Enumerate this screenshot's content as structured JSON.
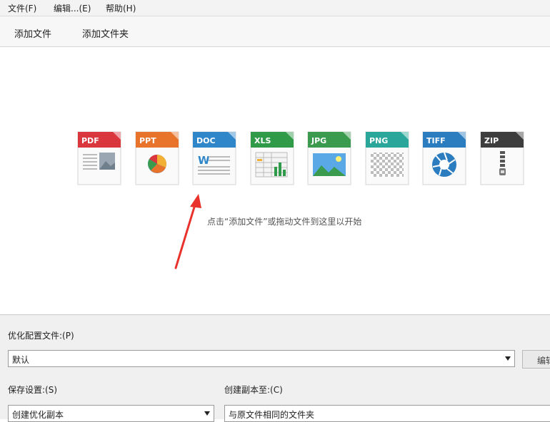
{
  "menu": {
    "file": "文件(F)",
    "edit": "编辑...(E)",
    "help": "帮助(H)"
  },
  "toolbar": {
    "add_file": "添加文件",
    "add_folder": "添加文件夹"
  },
  "file_types": [
    {
      "label": "PDF",
      "color": "#d9363e"
    },
    {
      "label": "PPT",
      "color": "#e8742c"
    },
    {
      "label": "DOC",
      "color": "#2f86c9"
    },
    {
      "label": "XLS",
      "color": "#2f9a48"
    },
    {
      "label": "JPG",
      "color": "#3a9a4e"
    },
    {
      "label": "PNG",
      "color": "#2aa69a"
    },
    {
      "label": "TIFF",
      "color": "#2c7cc0"
    },
    {
      "label": "ZIP",
      "color": "#3d3d3d"
    }
  ],
  "drop_hint": "点击“添加文件”或拖动文件到这里以开始",
  "profile": {
    "label": "优化配置文件:(P)",
    "value": "默认",
    "edit_button": "编辑"
  },
  "save": {
    "label": "保存设置:(S)",
    "value": "创建优化副本"
  },
  "copy_to": {
    "label": "创建副本至:(C)",
    "value": "与原文件相同的文件夹"
  },
  "colors": {
    "arrow": "#e8322b"
  }
}
